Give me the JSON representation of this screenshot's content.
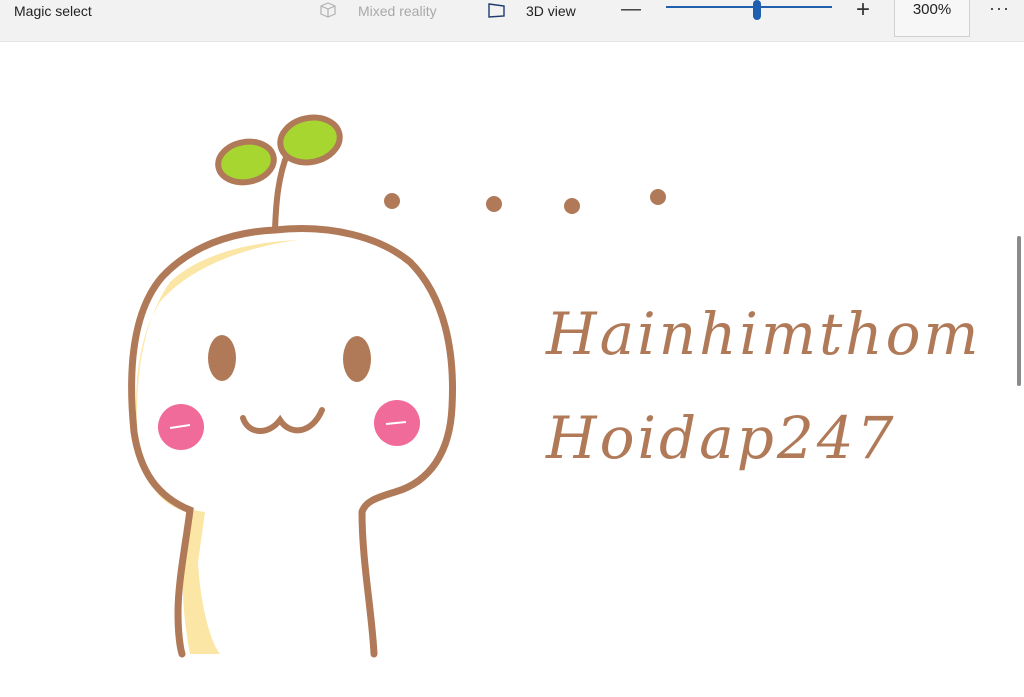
{
  "toolbar": {
    "magic_select": "Magic select",
    "mixed_reality": "Mixed reality",
    "view_3d": "3D view",
    "zoom_minus": "—",
    "zoom_plus": "+",
    "zoom_level": "300%",
    "zoom_fraction": 0.53,
    "more": "···"
  },
  "canvas": {
    "line1": "Hainhimthom",
    "line2": "Hoidap247"
  },
  "colors": {
    "outline": "#b07a58",
    "leaf": "#a8d630",
    "body_shade": "#fbe6a6",
    "cheek": "#f06a9a",
    "accent": "#1e5fae"
  }
}
